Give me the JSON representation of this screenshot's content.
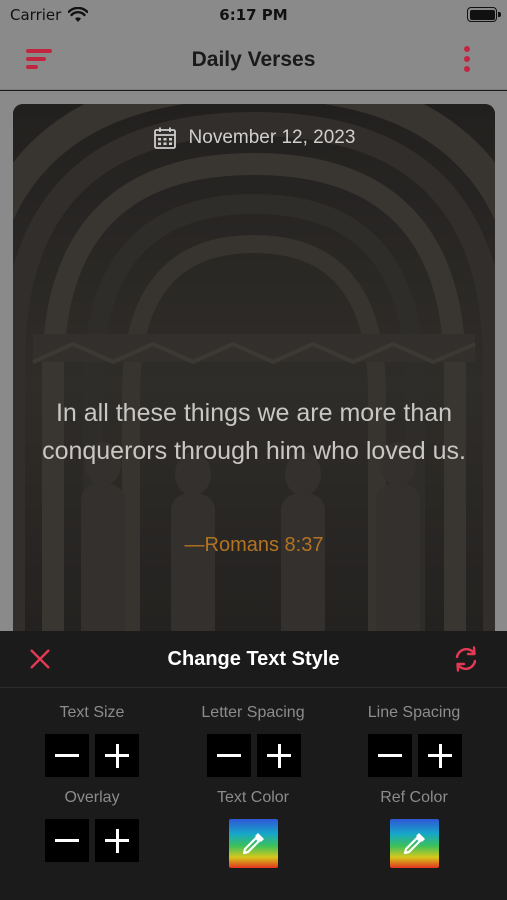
{
  "status_bar": {
    "carrier": "Carrier",
    "time": "6:17 PM"
  },
  "header": {
    "title": "Daily Verses",
    "menu_icon": "hamburger-menu-icon",
    "more_icon": "more-vertical-icon",
    "accent_color": "#c2263f"
  },
  "verse_card": {
    "date_icon": "calendar-icon",
    "date": "November 12, 2023",
    "verse": "In all these things we are more than conquerors through him who loved us.",
    "reference": "—Romans 8:37",
    "reference_color": "#b37422"
  },
  "style_panel": {
    "title": "Change Text Style",
    "close_icon": "close-icon",
    "reset_icon": "refresh-icon",
    "controls": [
      {
        "label": "Text Size",
        "type": "stepper"
      },
      {
        "label": "Letter Spacing",
        "type": "stepper"
      },
      {
        "label": "Line Spacing",
        "type": "stepper"
      },
      {
        "label": "Overlay",
        "type": "stepper"
      },
      {
        "label": "Text Color",
        "type": "color-picker"
      },
      {
        "label": "Ref Color",
        "type": "color-picker"
      }
    ]
  }
}
